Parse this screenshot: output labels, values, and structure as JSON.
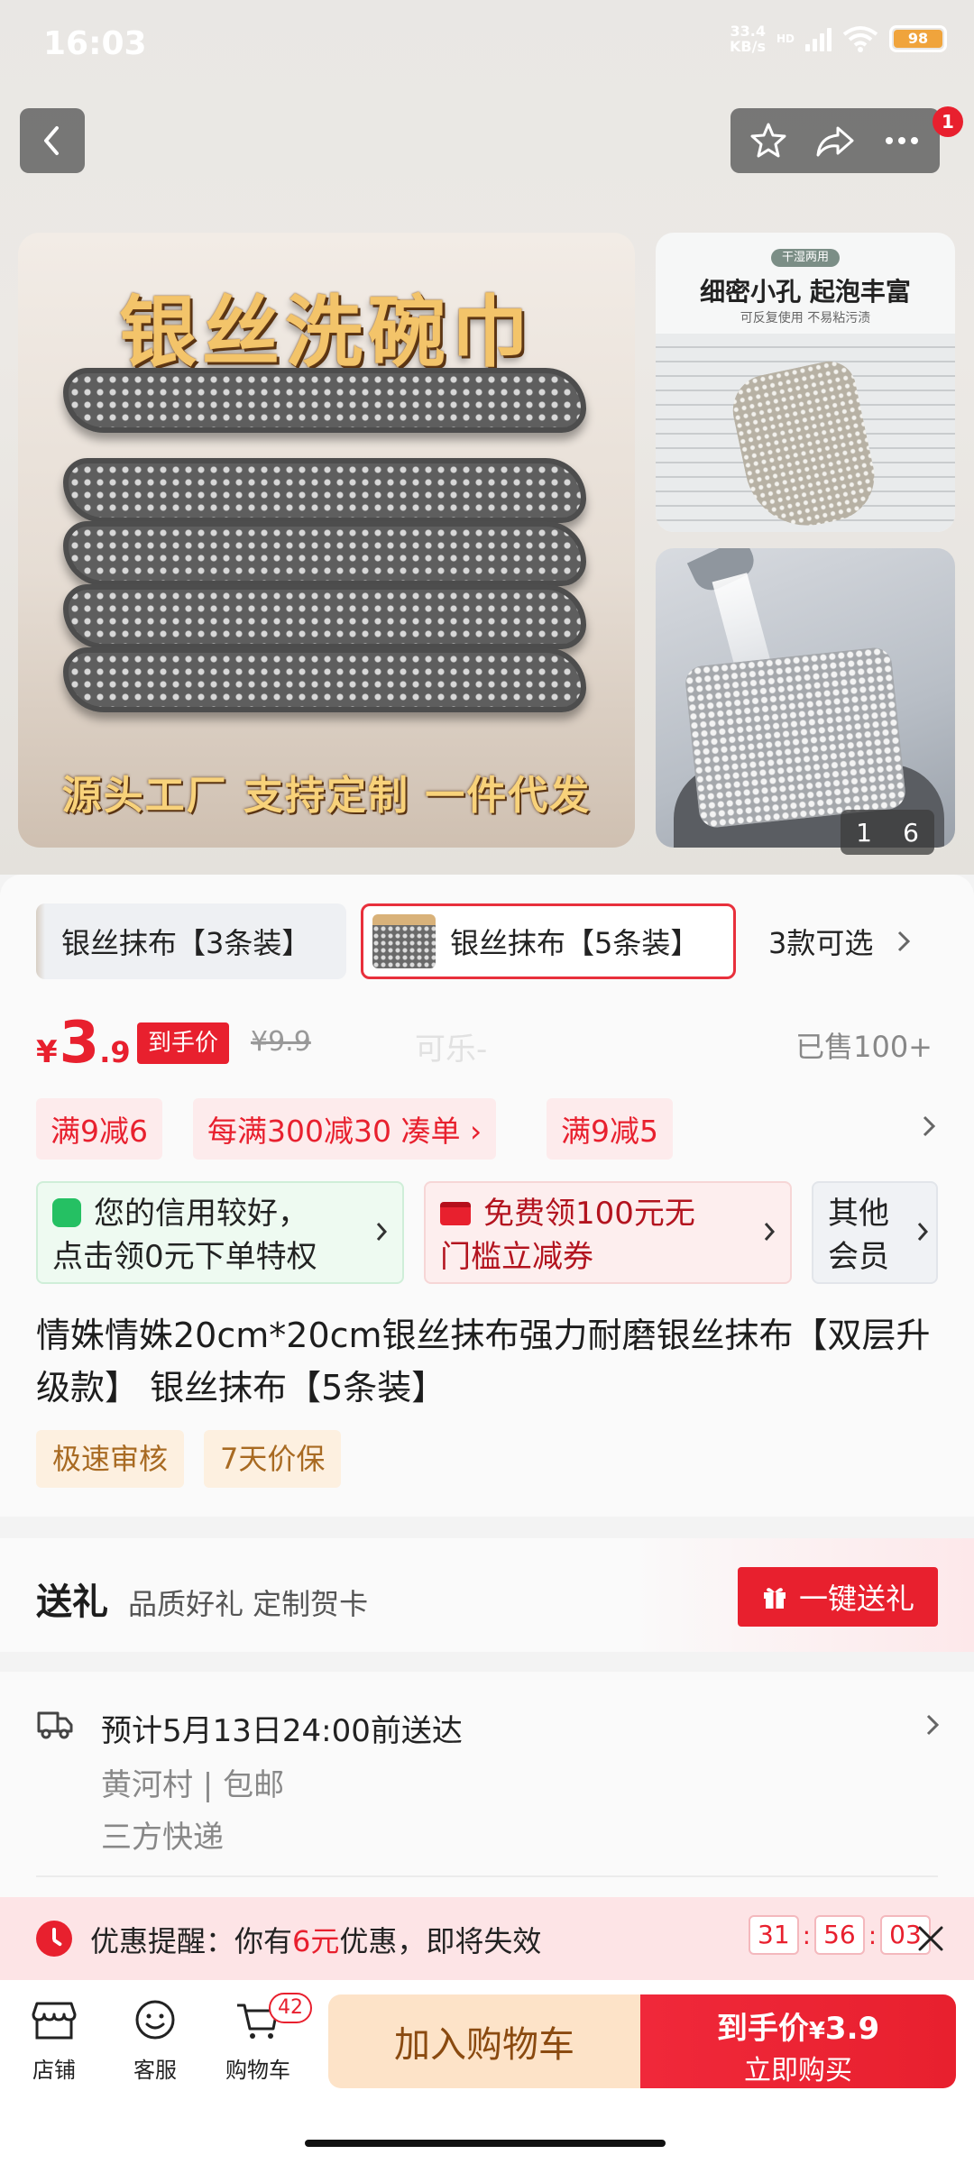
{
  "status_bar": {
    "time": "16:03",
    "speed_value": "33.4",
    "speed_unit": "KB/s",
    "network": "HD",
    "battery": "98"
  },
  "header": {
    "cart_badge_count": "1"
  },
  "gallery": {
    "main_title": "银丝洗碗巾",
    "main_caption": "源头工厂  支持定制  一件代发",
    "side1_pill": "干湿两用",
    "side1_title": "细密小孔 起泡丰富",
    "side1_sub": "可反复使用 不易粘污渍",
    "counter_current": "1",
    "counter_total": "6"
  },
  "sku": {
    "option1": "银丝抹布【3条装】",
    "option2": "银丝抹布【5条装】",
    "more": "3款可选"
  },
  "price": {
    "currency": "¥",
    "integer": "3",
    "decimal": ".9",
    "final_tag": "到手价",
    "original": "¥9.9",
    "watermark": "可乐-",
    "sold": "已售100+"
  },
  "promos": [
    {
      "label": "满9减6"
    },
    {
      "label": "每满300减30  凑单 ›"
    },
    {
      "label": "满9减5"
    }
  ],
  "benefits": {
    "credit_line1": "您的信用较好，",
    "credit_line2": "点击领0元下单特权",
    "coupon_line1": "免费领100元无",
    "coupon_line2": "门槛立减券",
    "member_line1": "其他",
    "member_line2": "会员"
  },
  "product": {
    "title": "情姝情姝20cm*20cm银丝抹布强力耐磨银丝抹布【双层升级款】 银丝抹布【5条装】",
    "chips": [
      "极速审核",
      "7天价保"
    ]
  },
  "gift": {
    "label": "送礼",
    "subtitle": "品质好礼 定制贺卡",
    "button": "一键送礼"
  },
  "delivery": {
    "eta": "预计5月13日24:00前送达",
    "location": "黄河村 | 包邮",
    "carrier": "三方快递"
  },
  "reminder": {
    "prefix": "优惠提醒：你有",
    "amount": "6元",
    "suffix": "优惠，即将失效",
    "hours": "31",
    "minutes": "56",
    "seconds": "03"
  },
  "bottom_bar": {
    "store": "店铺",
    "service": "客服",
    "cart": "购物车",
    "cart_count": "42",
    "add_to_cart": "加入购物车",
    "buy_label": "到手价",
    "buy_currency": "¥",
    "buy_price": "3.9",
    "buy_now": "立即购买"
  },
  "colors": {
    "accent_red": "#e8202e",
    "chip_text": "#a86a22",
    "credit_green": "#25c063"
  }
}
